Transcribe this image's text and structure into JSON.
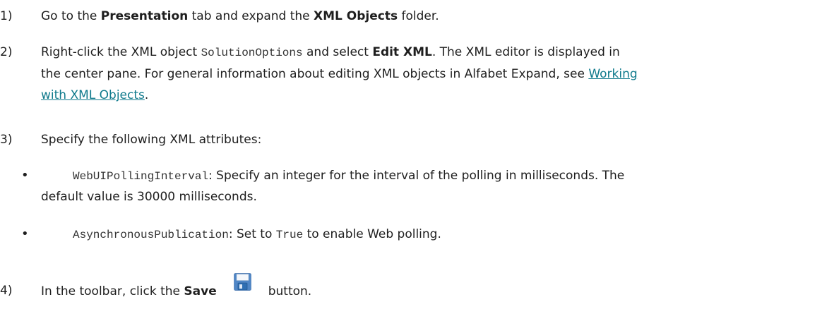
{
  "steps": [
    {
      "num": "1)",
      "p1": "Go to the ",
      "b1": "Presentation",
      "p2": " tab and expand the ",
      "b2": "XML Objects",
      "p3": " folder."
    },
    {
      "num": "2)",
      "p1": "Right-click the XML object ",
      "code1": "SolutionOptions",
      "p2": " and select ",
      "b1": "Edit XML",
      "p3": ". The XML editor is displayed in",
      "line2": "the center pane. For general information about editing XML objects in Alfabet Expand, see ",
      "link_part1": "Working",
      "link_part2": "with XML Objects",
      "p4": "."
    },
    {
      "num": "3)",
      "text": "Specify the following XML attributes:"
    },
    {
      "num": "4)",
      "p1": "In the toolbar, click the ",
      "b1": "Save",
      "p2": "button."
    }
  ],
  "bullets": [
    {
      "dot": "•",
      "code": "WebUIPollingInterval",
      "text": ": Specify an integer for the interval of the polling in milliseconds. The",
      "cont": "default value is 30000 milliseconds."
    },
    {
      "dot": "•",
      "code": "AsynchronousPublication",
      "text1": ": Set to ",
      "code2": "True",
      "text2": " to enable Web polling."
    }
  ],
  "icons": {
    "save": "save-floppy-icon"
  },
  "colors": {
    "link": "#0f7a8c",
    "text": "#1e1e1e"
  }
}
